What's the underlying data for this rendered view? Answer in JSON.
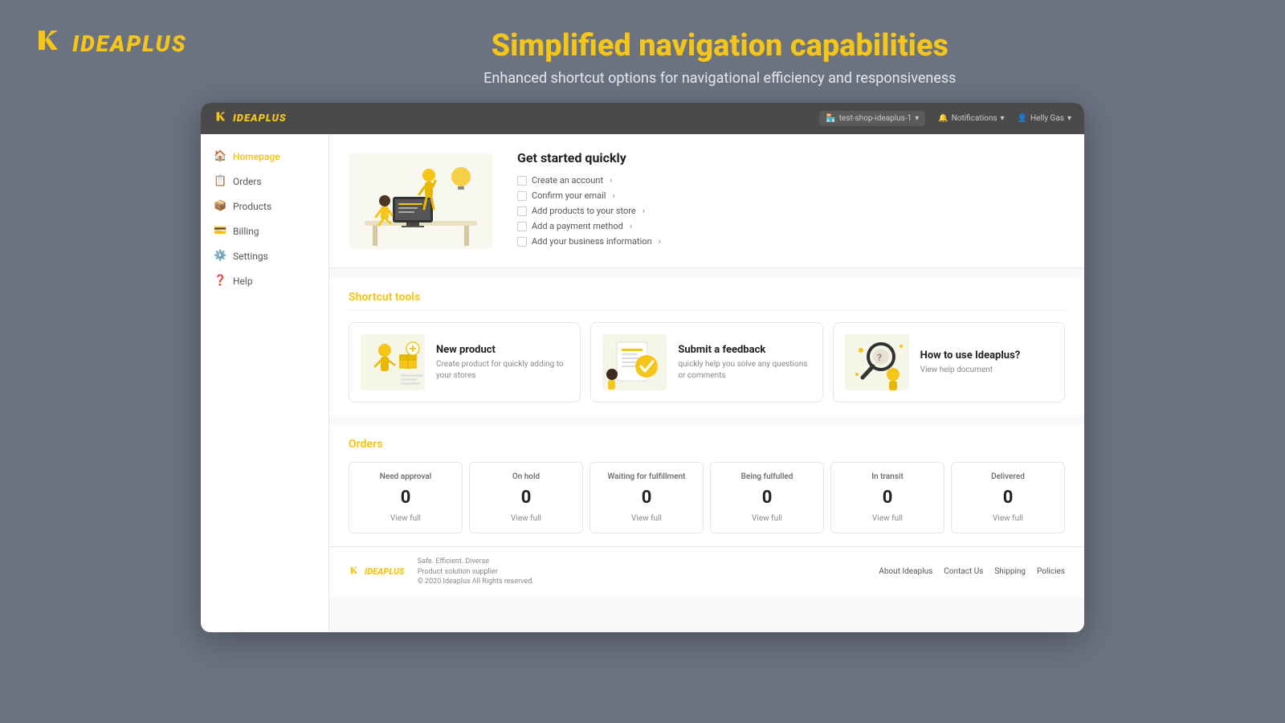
{
  "outer": {
    "brand_name": "IDEAPLUS",
    "main_title": "Simplified navigation capabilities",
    "subtitle": "Enhanced shortcut options for navigational efficiency and responsiveness"
  },
  "app_header": {
    "logo_text": "IDEAPLUS",
    "shop_selector": "test-shop-ideaplus-1",
    "notifications_label": "Notifications",
    "user_label": "Helly Gas"
  },
  "sidebar": {
    "items": [
      {
        "label": "Homepage",
        "icon": "🏠",
        "active": true
      },
      {
        "label": "Orders",
        "icon": "📋",
        "active": false
      },
      {
        "label": "Products",
        "icon": "📦",
        "active": false
      },
      {
        "label": "Billing",
        "icon": "💳",
        "active": false
      },
      {
        "label": "Settings",
        "icon": "⚙️",
        "active": false
      },
      {
        "label": "Help",
        "icon": "❓",
        "active": false
      }
    ]
  },
  "welcome": {
    "title": "Get started quickly",
    "checklist": [
      {
        "text": "Create an account",
        "done": false
      },
      {
        "text": "Confirm your email",
        "done": false
      },
      {
        "text": "Add products to your store",
        "done": false
      },
      {
        "text": "Add a payment method",
        "done": false
      },
      {
        "text": "Add your business information",
        "done": false
      }
    ]
  },
  "shortcuts": {
    "section_title": "Shortcut tools",
    "cards": [
      {
        "name": "New product",
        "description": "Create product for quickly adding to your stores"
      },
      {
        "name": "Submit a feedback",
        "description": "quickly help you solve any questions or comments"
      },
      {
        "name": "How to use Ideaplus?",
        "description": "View help document"
      }
    ]
  },
  "orders": {
    "section_title": "Orders",
    "cards": [
      {
        "label": "Need approval",
        "count": "0",
        "link": "View full"
      },
      {
        "label": "On hold",
        "count": "0",
        "link": "View full"
      },
      {
        "label": "Waiting for fulfillment",
        "count": "0",
        "link": "View full"
      },
      {
        "label": "Being fulfulled",
        "count": "0",
        "link": "View full"
      },
      {
        "label": "In transit",
        "count": "0",
        "link": "View full"
      },
      {
        "label": "Delivered",
        "count": "0",
        "link": "View full"
      }
    ]
  },
  "footer": {
    "brand_text": "IDEAPLUS",
    "tagline_line1": "Safe. Efficient. Diverse",
    "tagline_line2": "Product solution supplier",
    "tagline_line3": "© 2020 Ideaplus All Rights reserved.",
    "links": [
      "About Ideaplus",
      "Contact Us",
      "Shipping",
      "Policies"
    ]
  }
}
